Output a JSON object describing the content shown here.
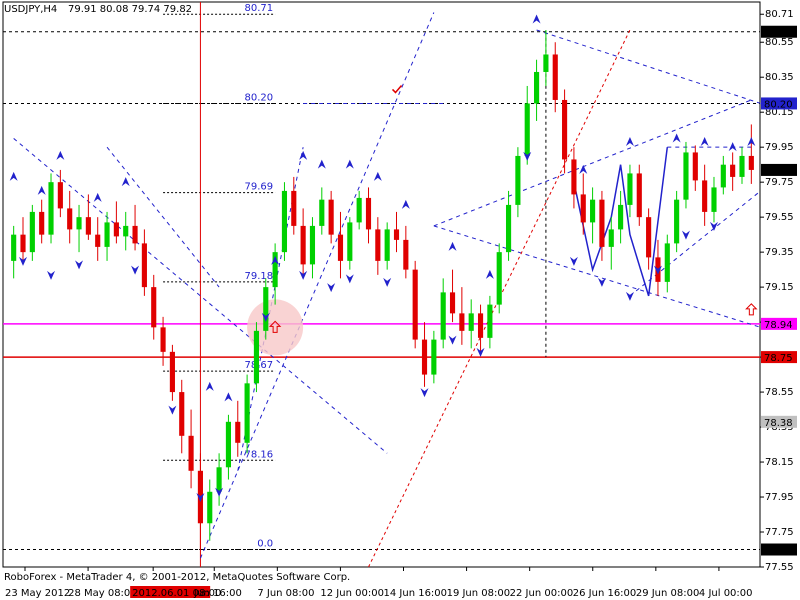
{
  "window": {
    "title": "USDJPY,H4",
    "ohlc": "79.91 80.08 79.74 79.82",
    "footer": "RoboForex - MetaTrader 4, © 2001-2012, MetaQuotes Software Corp."
  },
  "colors": {
    "background": "#ffffff",
    "bull": "#00d000",
    "bear": "#e00000",
    "grid": "#000000",
    "fib": "#2222cc",
    "support_line": "#ff00ff",
    "resistance_line": "#e00000",
    "trend_red": "#e00000",
    "highlight": "#f8c8c8"
  },
  "chart_data": {
    "type": "candlestick",
    "symbol": "USDJPY",
    "timeframe": "H4",
    "ylim": [
      77.55,
      80.78
    ],
    "y_ticks": [
      "80.71",
      "80.55",
      "80.35",
      "80.15",
      "79.95",
      "79.75",
      "79.55",
      "79.35",
      "79.15",
      "78.95",
      "78.75",
      "78.55",
      "78.35",
      "78.15",
      "77.95",
      "77.75",
      "77.55"
    ],
    "x_ticks": [
      "23 May 2012",
      "28 May 08:00",
      "2012.06.01 08:00",
      "Jun 16:00",
      "7 Jun 08:00",
      "12 Jun 00:00",
      "14 Jun 16:00",
      "19 Jun 08:00",
      "22 Jun 00:00",
      "26 Jun 16:00",
      "29 Jun 08:00",
      "4 Jul 00:00"
    ],
    "price_tags": [
      {
        "label": "80.61",
        "value": 80.61,
        "color": "#000000",
        "text": "#ffffff"
      },
      {
        "label": "80.20",
        "value": 80.2,
        "color": "#2222cc",
        "text": "#ffffff"
      },
      {
        "label": "79.82",
        "value": 79.82,
        "color": "#000000",
        "text": "#ffffff"
      },
      {
        "label": "78.94",
        "value": 78.94,
        "color": "#ff00ff",
        "text": "#ffffff"
      },
      {
        "label": "78.75",
        "value": 78.75,
        "color": "#e00000",
        "text": "#ffffff"
      },
      {
        "label": "78.38",
        "value": 78.38,
        "color": "#c0c0c0",
        "text": "#ffffff"
      },
      {
        "label": "77.65",
        "value": 77.65,
        "color": "#000000",
        "text": "#ffffff"
      }
    ],
    "fib_levels": [
      {
        "label": "80.71",
        "value": 80.71
      },
      {
        "label": "80.20",
        "value": 80.2
      },
      {
        "label": "79.69",
        "value": 79.69
      },
      {
        "label": "79.18",
        "value": 79.18
      },
      {
        "label": "78.67",
        "value": 78.67
      },
      {
        "label": "78.16",
        "value": 78.16
      },
      {
        "label": "0.0",
        "value": 77.65
      }
    ],
    "horizontal_levels": [
      {
        "name": "dashed-80.61",
        "value": 80.61,
        "color": "#000000",
        "style": "dashed"
      },
      {
        "name": "dashed-80.20",
        "value": 80.2,
        "color": "#000000",
        "style": "dashed"
      },
      {
        "name": "dashed-77.65",
        "value": 77.65,
        "color": "#000000",
        "style": "dashed"
      },
      {
        "name": "support-78.94",
        "value": 78.94,
        "color": "#ff00ff",
        "style": "solid"
      },
      {
        "name": "resistance-78.75",
        "value": 78.75,
        "color": "#e00000",
        "style": "solid"
      }
    ],
    "candles": [
      [
        79.3,
        79.5,
        79.2,
        79.45
      ],
      [
        79.45,
        79.55,
        79.3,
        79.35
      ],
      [
        79.35,
        79.62,
        79.3,
        79.58
      ],
      [
        79.58,
        79.65,
        79.4,
        79.45
      ],
      [
        79.45,
        79.8,
        79.4,
        79.75
      ],
      [
        79.75,
        79.82,
        79.55,
        79.6
      ],
      [
        79.6,
        79.7,
        79.4,
        79.48
      ],
      [
        79.48,
        79.62,
        79.35,
        79.55
      ],
      [
        79.55,
        79.68,
        79.42,
        79.45
      ],
      [
        79.45,
        79.55,
        79.3,
        79.38
      ],
      [
        79.38,
        79.58,
        79.3,
        79.52
      ],
      [
        79.52,
        79.64,
        79.4,
        79.44
      ],
      [
        79.44,
        79.58,
        79.36,
        79.5
      ],
      [
        79.5,
        79.62,
        79.36,
        79.4
      ],
      [
        79.4,
        79.48,
        79.1,
        79.15
      ],
      [
        79.15,
        79.22,
        78.85,
        78.92
      ],
      [
        78.92,
        78.98,
        78.7,
        78.78
      ],
      [
        78.78,
        78.82,
        78.5,
        78.55
      ],
      [
        78.55,
        78.62,
        78.2,
        78.3
      ],
      [
        78.3,
        78.45,
        78.0,
        78.1
      ],
      [
        78.1,
        78.2,
        77.65,
        77.8
      ],
      [
        77.8,
        78.05,
        77.7,
        77.98
      ],
      [
        77.98,
        78.2,
        77.9,
        78.12
      ],
      [
        78.12,
        78.42,
        78.05,
        78.38
      ],
      [
        78.38,
        78.5,
        78.18,
        78.26
      ],
      [
        78.26,
        78.65,
        78.2,
        78.6
      ],
      [
        78.6,
        78.95,
        78.55,
        78.9
      ],
      [
        78.9,
        79.2,
        78.85,
        79.15
      ],
      [
        79.15,
        79.4,
        79.05,
        79.35
      ],
      [
        79.35,
        79.75,
        79.3,
        79.7
      ],
      [
        79.7,
        79.78,
        79.45,
        79.5
      ],
      [
        79.5,
        79.6,
        79.2,
        79.28
      ],
      [
        79.28,
        79.55,
        79.2,
        79.5
      ],
      [
        79.5,
        79.72,
        79.45,
        79.65
      ],
      [
        79.65,
        79.7,
        79.4,
        79.45
      ],
      [
        79.45,
        79.58,
        79.2,
        79.3
      ],
      [
        79.3,
        79.55,
        79.25,
        79.52
      ],
      [
        79.52,
        79.7,
        79.48,
        79.66
      ],
      [
        79.66,
        79.72,
        79.4,
        79.48
      ],
      [
        79.48,
        79.55,
        79.22,
        79.3
      ],
      [
        79.3,
        79.52,
        79.25,
        79.48
      ],
      [
        79.48,
        79.58,
        79.35,
        79.42
      ],
      [
        79.42,
        79.5,
        79.2,
        79.25
      ],
      [
        79.25,
        79.3,
        78.8,
        78.85
      ],
      [
        78.85,
        78.95,
        78.58,
        78.65
      ],
      [
        78.65,
        78.9,
        78.6,
        78.85
      ],
      [
        78.85,
        79.2,
        78.8,
        79.12
      ],
      [
        79.12,
        79.25,
        78.95,
        79.0
      ],
      [
        79.0,
        79.15,
        78.82,
        78.9
      ],
      [
        78.9,
        79.08,
        78.8,
        79.0
      ],
      [
        79.0,
        79.05,
        78.78,
        78.86
      ],
      [
        78.86,
        79.1,
        78.8,
        79.05
      ],
      [
        79.05,
        79.4,
        79.0,
        79.35
      ],
      [
        79.35,
        79.7,
        79.3,
        79.62
      ],
      [
        79.62,
        79.95,
        79.55,
        79.9
      ],
      [
        79.9,
        80.3,
        79.85,
        80.2
      ],
      [
        80.2,
        80.45,
        80.1,
        80.38
      ],
      [
        80.38,
        80.62,
        80.3,
        80.48
      ],
      [
        80.48,
        80.55,
        80.15,
        80.22
      ],
      [
        80.22,
        80.28,
        79.8,
        79.88
      ],
      [
        79.88,
        79.95,
        79.6,
        79.68
      ],
      [
        79.68,
        79.8,
        79.45,
        79.52
      ],
      [
        79.52,
        79.72,
        79.4,
        79.65
      ],
      [
        79.65,
        79.7,
        79.3,
        79.38
      ],
      [
        79.38,
        79.55,
        79.25,
        79.48
      ],
      [
        79.48,
        79.7,
        79.4,
        79.62
      ],
      [
        79.62,
        79.85,
        79.55,
        79.8
      ],
      [
        79.8,
        79.85,
        79.5,
        79.55
      ],
      [
        79.55,
        79.6,
        79.25,
        79.32
      ],
      [
        79.32,
        79.42,
        79.1,
        79.18
      ],
      [
        79.18,
        79.45,
        79.12,
        79.4
      ],
      [
        79.4,
        79.7,
        79.35,
        79.65
      ],
      [
        79.65,
        79.98,
        79.6,
        79.92
      ],
      [
        79.92,
        79.96,
        79.7,
        79.76
      ],
      [
        79.76,
        79.85,
        79.5,
        79.58
      ],
      [
        79.58,
        79.78,
        79.52,
        79.72
      ],
      [
        79.72,
        79.9,
        79.68,
        79.85
      ],
      [
        79.85,
        79.92,
        79.7,
        79.78
      ],
      [
        79.78,
        79.95,
        79.74,
        79.9
      ],
      [
        79.9,
        80.08,
        79.74,
        79.82
      ]
    ],
    "up_arrows": [
      [
        0,
        79.78
      ],
      [
        3,
        79.7
      ],
      [
        5,
        79.9
      ],
      [
        9,
        79.66
      ],
      [
        12,
        79.75
      ],
      [
        21,
        78.58
      ],
      [
        23,
        78.52
      ],
      [
        28,
        79.3
      ],
      [
        31,
        79.9
      ],
      [
        33,
        79.85
      ],
      [
        36,
        79.85
      ],
      [
        39,
        79.78
      ],
      [
        42,
        79.62
      ],
      [
        47,
        79.38
      ],
      [
        51,
        79.22
      ],
      [
        56,
        80.68
      ],
      [
        61,
        79.82
      ],
      [
        66,
        79.98
      ],
      [
        71,
        80.0
      ],
      [
        74,
        79.98
      ],
      [
        77,
        79.95
      ],
      [
        79,
        79.98
      ]
    ],
    "down_arrows": [
      [
        1,
        79.3
      ],
      [
        4,
        79.22
      ],
      [
        7,
        79.28
      ],
      [
        13,
        79.25
      ],
      [
        17,
        78.45
      ],
      [
        20,
        77.95
      ],
      [
        22,
        77.98
      ],
      [
        27,
        78.98
      ],
      [
        31,
        79.22
      ],
      [
        34,
        79.15
      ],
      [
        36,
        79.2
      ],
      [
        40,
        79.18
      ],
      [
        44,
        78.55
      ],
      [
        47,
        78.85
      ],
      [
        50,
        78.78
      ],
      [
        55,
        79.9
      ],
      [
        60,
        79.3
      ],
      [
        63,
        79.18
      ],
      [
        66,
        79.1
      ],
      [
        69,
        79.25
      ],
      [
        72,
        79.45
      ],
      [
        75,
        79.5
      ]
    ],
    "annotations": {
      "checkmark": {
        "candle": 41,
        "value": 80.28
      },
      "target_arrow": {
        "candle": 79,
        "value": 79.02
      },
      "highlight_arrow": {
        "candle": 28,
        "value": 78.92
      }
    }
  }
}
